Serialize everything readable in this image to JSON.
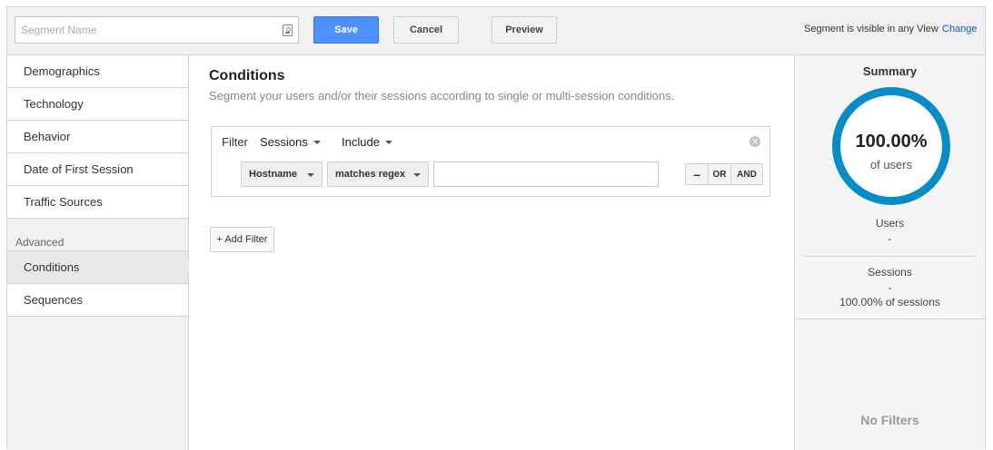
{
  "header": {
    "segment_name_placeholder": "Segment Name",
    "save_label": "Save",
    "cancel_label": "Cancel",
    "preview_label": "Preview",
    "visibility_text": "Segment is visible in any View",
    "change_label": "Change"
  },
  "sidebar": {
    "items": [
      {
        "label": "Demographics"
      },
      {
        "label": "Technology"
      },
      {
        "label": "Behavior"
      },
      {
        "label": "Date of First Session"
      },
      {
        "label": "Traffic Sources"
      }
    ],
    "advanced_label": "Advanced",
    "advanced_items": [
      {
        "label": "Conditions",
        "active": true
      },
      {
        "label": "Sequences",
        "active": false
      }
    ]
  },
  "main": {
    "title": "Conditions",
    "subtitle": "Segment your users and/or their sessions according to single or multi-session conditions.",
    "filter": {
      "label": "Filter",
      "scope": "Sessions",
      "mode": "Include",
      "dimension": "Hostname",
      "operator": "matches regex",
      "value": "",
      "minus_label": "–",
      "or_label": "OR",
      "and_label": "AND"
    },
    "add_filter_label": "+ Add Filter"
  },
  "summary": {
    "title": "Summary",
    "percent": "100.00%",
    "percent_sub": "of users",
    "users_label": "Users",
    "users_value": "-",
    "sessions_label": "Sessions",
    "sessions_value": "-",
    "sessions_pct": "100.00% of sessions",
    "no_filters": "No Filters",
    "ring_color": "#058dc7"
  }
}
